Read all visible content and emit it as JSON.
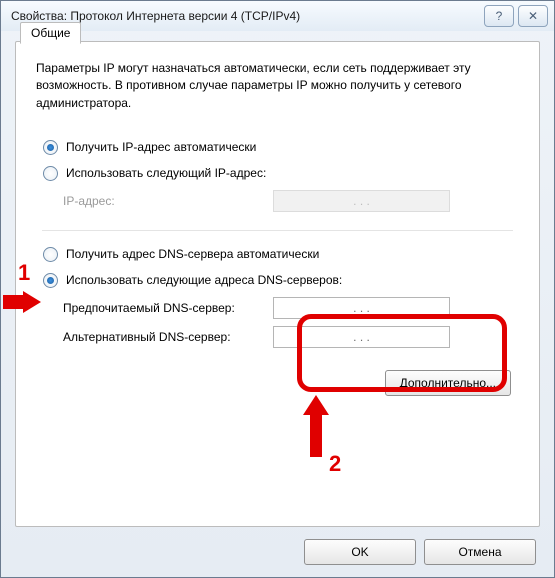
{
  "window": {
    "title": "Cвойства: Протокол Интернета версии 4 (TCP/IPv4)"
  },
  "tab": {
    "label": "Общие"
  },
  "description": "Параметры IP могут назначаться автоматически, если сеть поддерживает эту возможность. В противном случае параметры IP можно получить у сетевого администратора.",
  "ip_mode": {
    "auto": "Получить IP-адрес автоматически",
    "manual": "Использовать следующий IP-адрес:",
    "selected": "auto",
    "fields": {
      "ip_label": "IP-адрес:",
      "ip_value": "   .       .       .   "
    }
  },
  "dns_mode": {
    "auto": "Получить адрес DNS-сервера автоматически",
    "manual": "Использовать следующие адреса DNS-серверов:",
    "selected": "manual",
    "fields": {
      "preferred_label": "Предпочитаемый DNS-сервер:",
      "preferred_value": ".       .       .",
      "alt_label": "Альтернативный DNS-сервер:",
      "alt_value": ".       .       ."
    }
  },
  "buttons": {
    "advanced": "Дополнительно...",
    "ok": "OK",
    "cancel": "Отмена"
  },
  "annotations": {
    "one": "1",
    "two": "2"
  }
}
